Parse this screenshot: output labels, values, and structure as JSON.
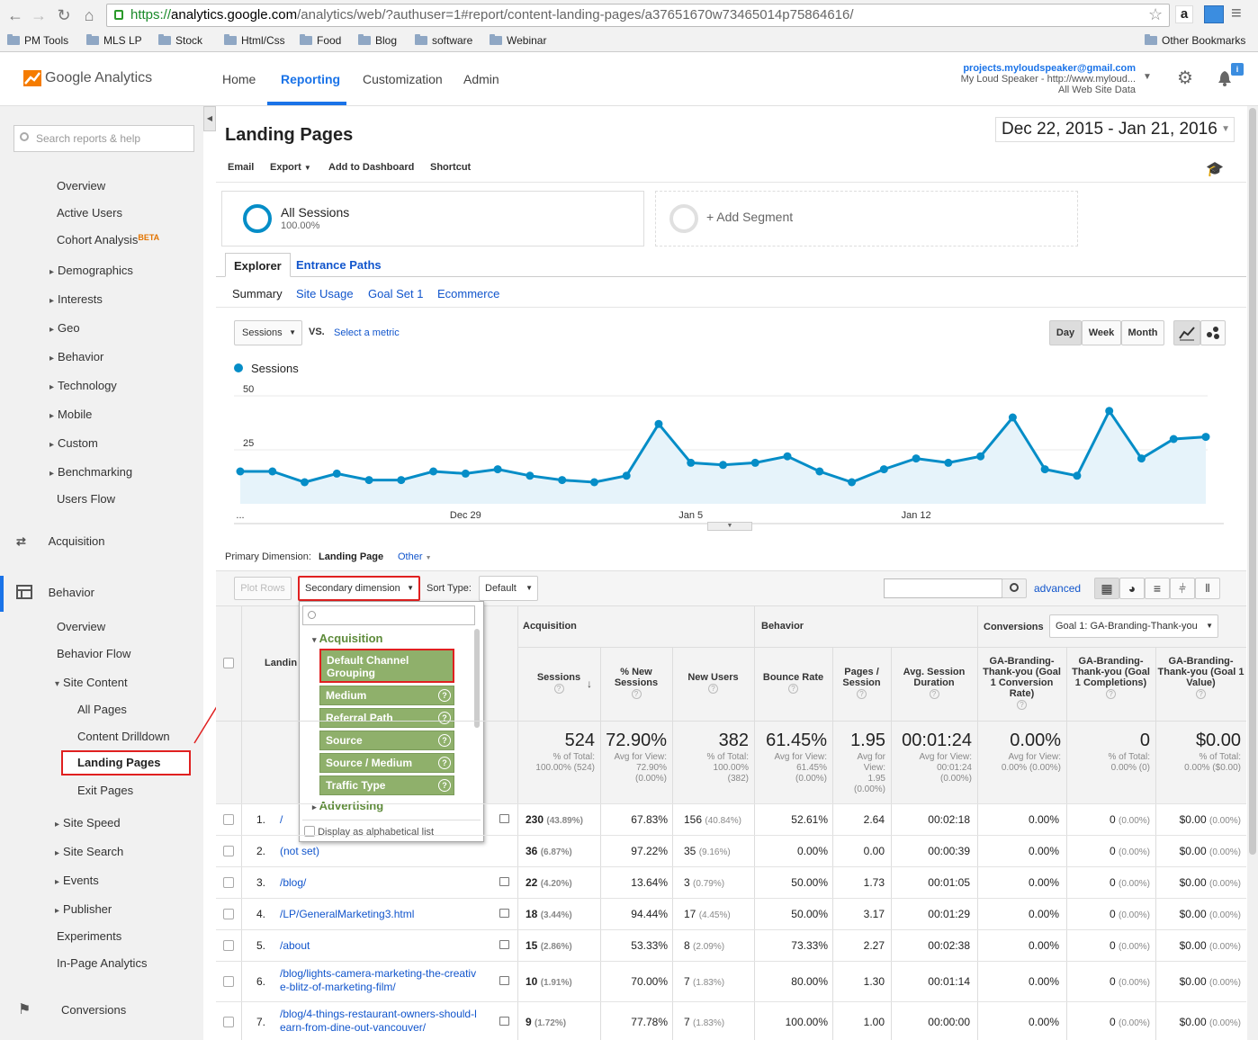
{
  "browser": {
    "url_https": "https://",
    "url_host": "analytics.google.com",
    "url_rest": "/analytics/web/?authuser=1#report/content-landing-pages/a37651670w73465014p75864616/",
    "bookmarks": [
      "PM Tools",
      "MLS LP",
      "Stock",
      "Html/Css",
      "Food",
      "Blog",
      "software",
      "Webinar"
    ],
    "other_bookmarks": "Other Bookmarks"
  },
  "header": {
    "logo": "Google Analytics",
    "nav": [
      "Home",
      "Reporting",
      "Customization",
      "Admin"
    ],
    "account_email": "projects.myloudspeaker@gmail.com",
    "account_name": "My Loud Speaker - http://www.myloud...",
    "account_view": "All Web Site Data",
    "notif_badge": "i"
  },
  "sidebar": {
    "search_placeholder": "Search reports & help",
    "audience": [
      "Overview",
      "Active Users",
      "Cohort Analysis",
      "Demographics",
      "Interests",
      "Geo",
      "Behavior",
      "Technology",
      "Mobile",
      "Custom",
      "Benchmarking",
      "Users Flow"
    ],
    "beta": "BETA",
    "acquisition": "Acquisition",
    "behavior": "Behavior",
    "behavior_items": [
      "Overview",
      "Behavior Flow",
      "Site Content",
      "All Pages",
      "Content Drilldown",
      "Landing Pages",
      "Exit Pages",
      "Site Speed",
      "Site Search",
      "Events",
      "Publisher",
      "Experiments",
      "In-Page Analytics"
    ],
    "conversions": "Conversions"
  },
  "report": {
    "title": "Landing Pages",
    "date_range": "Dec 22, 2015 - Jan 21, 2016",
    "toolbar": [
      "Email",
      "Export",
      "Add to Dashboard",
      "Shortcut"
    ],
    "segment_name": "All Sessions",
    "segment_pct": "100.00%",
    "add_segment": "+ Add Segment",
    "tabs": [
      "Explorer",
      "Entrance Paths"
    ],
    "subtabs": [
      "Summary",
      "Site Usage",
      "Goal Set 1",
      "Ecommerce"
    ],
    "metric": "Sessions",
    "vs": "VS.",
    "select_metric": "Select a metric",
    "periods": [
      "Day",
      "Week",
      "Month"
    ],
    "legend": "Sessions",
    "primary_dim_label": "Primary Dimension:",
    "primary_dim": "Landing Page",
    "other": "Other",
    "plot_rows": "Plot Rows",
    "secondary_dim": "Secondary dimension",
    "sort_type_label": "Sort Type:",
    "sort_type": "Default",
    "advanced": "advanced"
  },
  "chart_data": {
    "type": "line",
    "title": "",
    "series": [
      {
        "name": "Sessions",
        "values": [
          15,
          15,
          10,
          14,
          11,
          11,
          15,
          14,
          16,
          13,
          11,
          10,
          13,
          37,
          19,
          18,
          19,
          22,
          15,
          10,
          16,
          21,
          19,
          22,
          40,
          16,
          13,
          43,
          21,
          30,
          31
        ]
      }
    ],
    "ylim": [
      0,
      50
    ],
    "yticks": [
      25,
      50
    ],
    "xtick_labels": [
      "...",
      "Dec 29",
      "Jan 5",
      "Jan 12"
    ],
    "xtick_index": [
      0,
      7,
      14,
      21
    ],
    "grid": true,
    "color": "#058dc7"
  },
  "dropdown": {
    "group": "Acquisition",
    "selected": "Default Channel Grouping",
    "items": [
      "Medium",
      "Referral Path",
      "Source",
      "Source / Medium",
      "Traffic Type"
    ],
    "next_group": "Advertising",
    "alpha": "Display as alphabetical list"
  },
  "table": {
    "group_acq": "Acquisition",
    "group_beh": "Behavior",
    "group_conv": "Conversions",
    "goal_select": "Goal 1: GA-Branding-Thank-you",
    "landing_col": "Landin",
    "cols": [
      "Sessions",
      "% New Sessions",
      "New Users",
      "Bounce Rate",
      "Pages / Session",
      "Avg. Session Duration",
      "GA-Branding-Thank-you (Goal 1 Conversion Rate)",
      "GA-Branding-Thank-you (Goal 1 Completions)",
      "GA-Branding-Thank-you (Goal 1 Value)"
    ],
    "totals": [
      {
        "big": "524",
        "sm": [
          "% of Total:",
          "100.00% (524)"
        ]
      },
      {
        "big": "72.90%",
        "sm": [
          "Avg for View:",
          "72.90%",
          "(0.00%)"
        ]
      },
      {
        "big": "382",
        "sm": [
          "% of Total:",
          "100.00%",
          "(382)"
        ]
      },
      {
        "big": "61.45%",
        "sm": [
          "Avg for View:",
          "61.45%",
          "(0.00%)"
        ]
      },
      {
        "big": "1.95",
        "sm": [
          "Avg for",
          "View:",
          "1.95",
          "(0.00%)"
        ]
      },
      {
        "big": "00:01:24",
        "sm": [
          "Avg for View:",
          "00:01:24",
          "(0.00%)"
        ]
      },
      {
        "big": "0.00%",
        "sm": [
          "Avg for View:",
          "0.00% (0.00%)"
        ]
      },
      {
        "big": "0",
        "sm": [
          "% of Total:",
          "0.00% (0)"
        ]
      },
      {
        "big": "$0.00",
        "sm": [
          "% of Total:",
          "0.00% ($0.00)"
        ]
      }
    ],
    "rows": [
      {
        "n": "1.",
        "page": [
          "/"
        ],
        "ext": true,
        "sessions": "230",
        "s_pct": "(43.89%)",
        "new_sess": "67.83%",
        "new_users": "156",
        "nu_pct": "(40.84%)",
        "bounce": "52.61%",
        "pps": "2.64",
        "dur": "00:02:18",
        "cr": "0.00%",
        "comp": "0",
        "comp_pct": "(0.00%)",
        "val": "$0.00",
        "val_pct": "(0.00%)"
      },
      {
        "n": "2.",
        "page": [
          "(not set)"
        ],
        "ext": false,
        "sessions": "36",
        "s_pct": "(6.87%)",
        "new_sess": "97.22%",
        "new_users": "35",
        "nu_pct": "(9.16%)",
        "bounce": "0.00%",
        "pps": "0.00",
        "dur": "00:00:39",
        "cr": "0.00%",
        "comp": "0",
        "comp_pct": "(0.00%)",
        "val": "$0.00",
        "val_pct": "(0.00%)"
      },
      {
        "n": "3.",
        "page": [
          "/blog/"
        ],
        "ext": true,
        "sessions": "22",
        "s_pct": "(4.20%)",
        "new_sess": "13.64%",
        "new_users": "3",
        "nu_pct": "(0.79%)",
        "bounce": "50.00%",
        "pps": "1.73",
        "dur": "00:01:05",
        "cr": "0.00%",
        "comp": "0",
        "comp_pct": "(0.00%)",
        "val": "$0.00",
        "val_pct": "(0.00%)"
      },
      {
        "n": "4.",
        "page": [
          "/LP/GeneralMarketing3.html"
        ],
        "ext": true,
        "sessions": "18",
        "s_pct": "(3.44%)",
        "new_sess": "94.44%",
        "new_users": "17",
        "nu_pct": "(4.45%)",
        "bounce": "50.00%",
        "pps": "3.17",
        "dur": "00:01:29",
        "cr": "0.00%",
        "comp": "0",
        "comp_pct": "(0.00%)",
        "val": "$0.00",
        "val_pct": "(0.00%)"
      },
      {
        "n": "5.",
        "page": [
          "/about"
        ],
        "ext": true,
        "sessions": "15",
        "s_pct": "(2.86%)",
        "new_sess": "53.33%",
        "new_users": "8",
        "nu_pct": "(2.09%)",
        "bounce": "73.33%",
        "pps": "2.27",
        "dur": "00:02:38",
        "cr": "0.00%",
        "comp": "0",
        "comp_pct": "(0.00%)",
        "val": "$0.00",
        "val_pct": "(0.00%)"
      },
      {
        "n": "6.",
        "page": [
          "/blog/lights-camera-marketing-the-creativ",
          "e-blitz-of-marketing-film/"
        ],
        "ext": true,
        "sessions": "10",
        "s_pct": "(1.91%)",
        "new_sess": "70.00%",
        "new_users": "7",
        "nu_pct": "(1.83%)",
        "bounce": "80.00%",
        "pps": "1.30",
        "dur": "00:01:14",
        "cr": "0.00%",
        "comp": "0",
        "comp_pct": "(0.00%)",
        "val": "$0.00",
        "val_pct": "(0.00%)"
      },
      {
        "n": "7.",
        "page": [
          "/blog/4-things-restaurant-owners-should-l",
          "earn-from-dine-out-vancouver/"
        ],
        "ext": true,
        "sessions": "9",
        "s_pct": "(1.72%)",
        "new_sess": "77.78%",
        "new_users": "7",
        "nu_pct": "(1.83%)",
        "bounce": "100.00%",
        "pps": "1.00",
        "dur": "00:00:00",
        "cr": "0.00%",
        "comp": "0",
        "comp_pct": "(0.00%)",
        "val": "$0.00",
        "val_pct": "(0.00%)"
      }
    ]
  }
}
